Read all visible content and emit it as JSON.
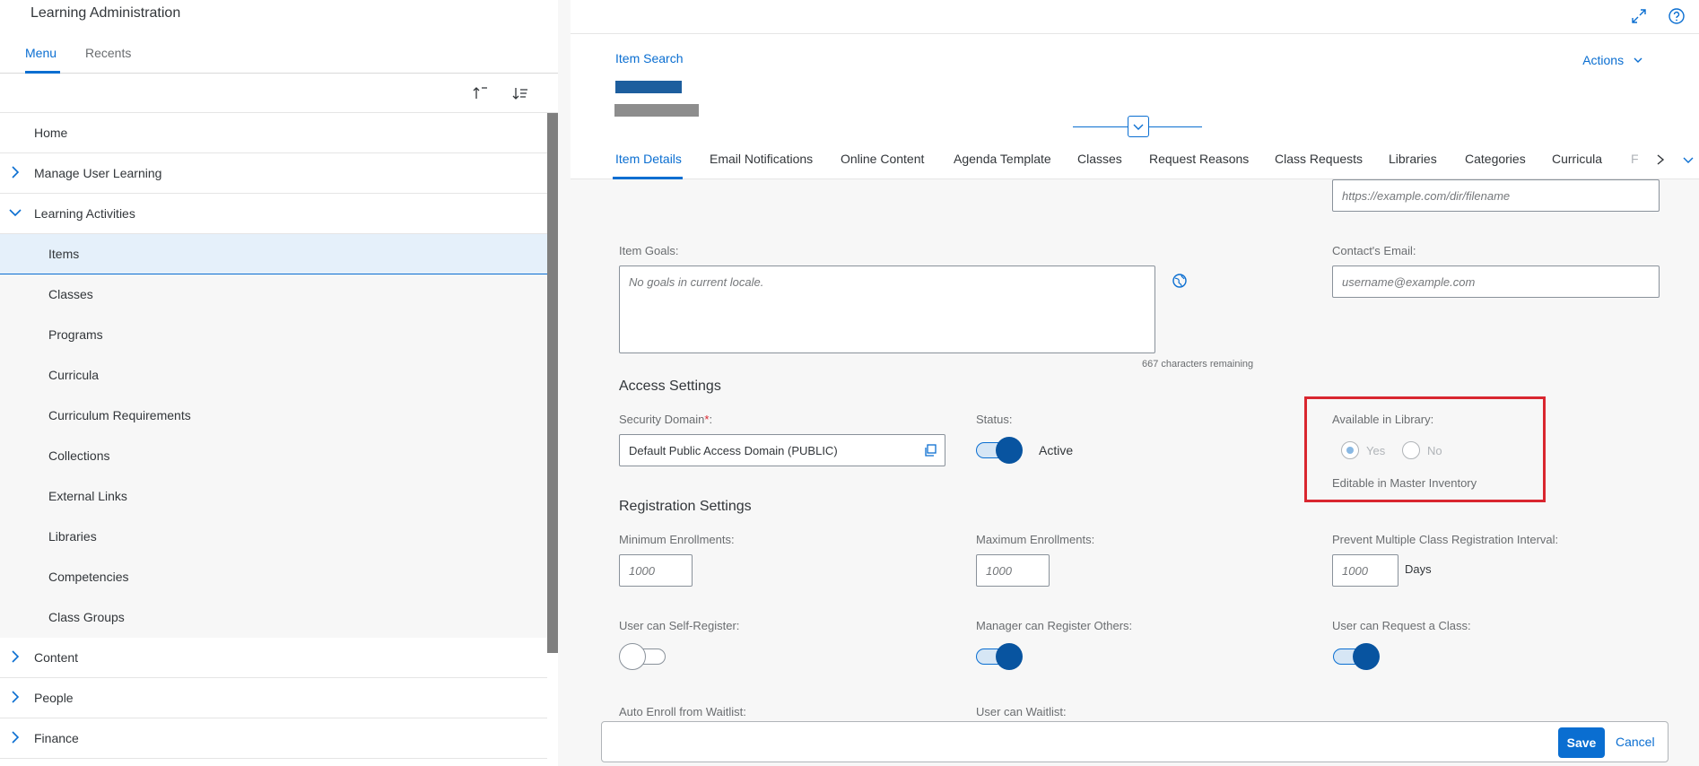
{
  "left": {
    "app_title": "Learning Administration",
    "tabs": [
      {
        "label": "Menu"
      },
      {
        "label": "Recents"
      }
    ],
    "menu": [
      {
        "label": "Home"
      },
      {
        "label": "Manage User Learning"
      },
      {
        "label": "Learning Activities"
      },
      {
        "label": "Items"
      },
      {
        "label": "Classes"
      },
      {
        "label": "Programs"
      },
      {
        "label": "Curricula"
      },
      {
        "label": "Curriculum Requirements"
      },
      {
        "label": "Collections"
      },
      {
        "label": "External Links"
      },
      {
        "label": "Libraries"
      },
      {
        "label": "Competencies"
      },
      {
        "label": "Class Groups"
      },
      {
        "label": "Content"
      },
      {
        "label": "People"
      },
      {
        "label": "Finance"
      }
    ]
  },
  "header": {
    "breadcrumb": "Item Search",
    "actions_label": "Actions"
  },
  "tabs": [
    {
      "label": "Item Details"
    },
    {
      "label": "Email Notifications"
    },
    {
      "label": "Online Content"
    },
    {
      "label": "Agenda Template"
    },
    {
      "label": "Classes"
    },
    {
      "label": "Request Reasons"
    },
    {
      "label": "Class Requests"
    },
    {
      "label": "Libraries"
    },
    {
      "label": "Categories"
    },
    {
      "label": "Curricula"
    },
    {
      "label": "F"
    }
  ],
  "form": {
    "url_placeholder": "https://example.com/dir/filename",
    "item_goals_label": "Item Goals:",
    "item_goals_placeholder": "No goals in current locale.",
    "chars_remaining": "667 characters remaining",
    "contact_email_label": "Contact's Email:",
    "contact_email_placeholder": "username@example.com",
    "access_settings": "Access Settings",
    "security_domain_label": "Security Domain",
    "required_mark": "*",
    "security_domain_suffix": ":",
    "security_domain_value": "Default Public Access Domain (PUBLIC)",
    "status_label": "Status:",
    "status_value": "Active",
    "available_library_label": "Available in Library:",
    "yes_label": "Yes",
    "no_label": "No",
    "editable_master": "Editable in Master Inventory",
    "registration_settings": "Registration Settings",
    "min_enroll_label": "Minimum Enrollments:",
    "min_enroll_placeholder": "1000",
    "max_enroll_label": "Maximum Enrollments:",
    "max_enroll_placeholder": "1000",
    "prevent_interval_label": "Prevent Multiple Class Registration Interval:",
    "prevent_interval_placeholder": "1000",
    "days_label": "Days",
    "self_register_label": "User can Self-Register:",
    "manager_register_label": "Manager can Register Others:",
    "request_class_label": "User can Request a Class:",
    "auto_enroll_label": "Auto Enroll from Waitlist:",
    "user_waitlist_label": "User can Waitlist:"
  },
  "footer": {
    "save_label": "Save",
    "cancel_label": "Cancel"
  },
  "colors": {
    "accent": "#0a6ed1",
    "highlight": "#d9262f"
  }
}
